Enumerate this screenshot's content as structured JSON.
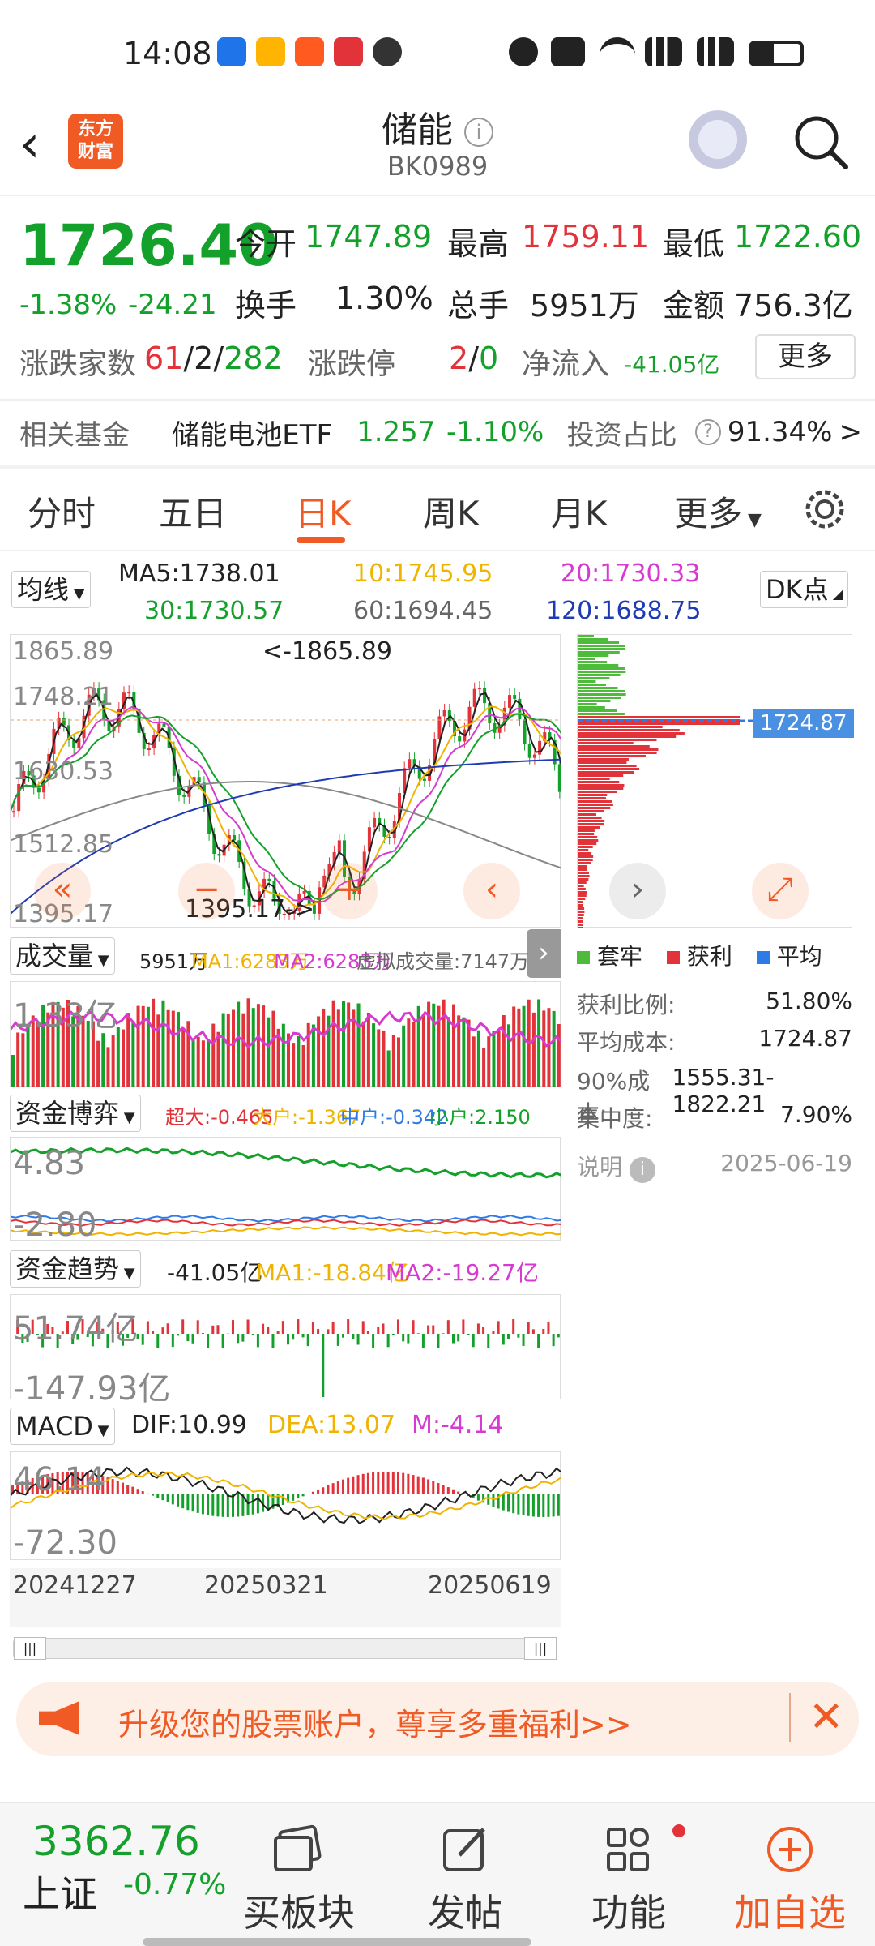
{
  "status_bar": {
    "time": "14:08",
    "icons": [
      "weibo-icon",
      "alipay-icon",
      "taobao-icon",
      "app-icon",
      "plane-icon",
      "alarm-icon",
      "hd-icon",
      "wifi-icon",
      "signal-5g-icon",
      "signal-5g-icon",
      "battery-icon"
    ]
  },
  "header": {
    "logo": "东方\n财富",
    "title": "储能",
    "code": "BK0989"
  },
  "quote": {
    "price": "1726.40",
    "change_pct": "-1.38%",
    "change": "-24.21",
    "open_label": "今开",
    "open": "1747.89",
    "high_label": "最高",
    "high": "1759.11",
    "low_label": "最低",
    "low": "1722.60",
    "turnover_label": "换手",
    "turnover": "1.30%",
    "volume_label": "总手",
    "volume": "5951万",
    "amount_label": "金额",
    "amount": "756.3亿",
    "updown_label": "涨跌家数",
    "up": "61",
    "flat": "2",
    "down": "282",
    "limit_label": "涨跌停",
    "limit_up": "2",
    "limit_down": "0",
    "netflow_label": "净流入",
    "netflow": "-41.05亿",
    "more_button": "更多"
  },
  "fund": {
    "label": "相关基金",
    "name": "储能电池ETF",
    "price": "1.257",
    "pct": "-1.10%",
    "ratio_label": "投资占比",
    "ratio": "91.34%"
  },
  "tabs": [
    "分时",
    "五日",
    "日K",
    "周K",
    "月K",
    "更多"
  ],
  "kline": {
    "ma_selector": "均线",
    "ma5": "MA5:1738.01",
    "ma10": "10:1745.95",
    "ma20": "20:1730.33",
    "ma30": "30:1730.57",
    "ma60": "60:1694.45",
    "ma120": "120:1688.75",
    "dk_button": "DK点",
    "y_labels": [
      "1865.89",
      "1748.21",
      "1630.53",
      "1512.85",
      "1395.17"
    ],
    "max_annot": "<-1865.89",
    "min_annot": "1395.17->",
    "dist_price": "1724.87",
    "colors": {
      "ma5": "#222222",
      "ma10": "#f0b400",
      "ma20": "#d63ad0",
      "ma30": "#14a12b",
      "ma60": "#888888",
      "ma120": "#1f3bb3"
    }
  },
  "volume": {
    "selector": "成交量",
    "vol": "5951万",
    "ma1": "MA1:6283万",
    "ma2": "MA2:6283万",
    "virtual": "虚拟成交量:7147万",
    "y_label": "1.33亿"
  },
  "capital_game": {
    "selector": "资金博弈",
    "big": "超大:-0.465",
    "large": "大户:-1.367",
    "mid": "中户:-0.342",
    "small": "小户:2.150",
    "y_top": "4.83",
    "y_bottom": "-2.80"
  },
  "capital_trend": {
    "selector": "资金趋势",
    "value": "-41.05亿",
    "ma1": "MA1:-18.84亿",
    "ma2": "MA2:-19.27亿",
    "y_top": "51.74亿",
    "y_bottom": "-147.93亿"
  },
  "macd": {
    "selector": "MACD",
    "dif": "DIF:10.99",
    "dea": "DEA:13.07",
    "m": "M:-4.14",
    "y_top": "46.14",
    "y_bottom": "-72.30"
  },
  "dates": [
    "20241227",
    "20250321",
    "20250619"
  ],
  "chip": {
    "legend": [
      "套牢",
      "获利",
      "平均"
    ],
    "profit_ratio_label": "获利比例:",
    "profit_ratio": "51.80%",
    "avg_cost_label": "平均成本:",
    "avg_cost": "1724.87",
    "cost90_label": "90%成本:",
    "cost90": "1555.31-1822.21",
    "concentration_label": "集中度:",
    "concentration": "7.90%",
    "note_label": "说明",
    "date": "2025-06-19"
  },
  "banner": {
    "text": "升级您的股票账户，尊享多重福利>>"
  },
  "bottom_nav": {
    "index_price": "3362.76",
    "index_name": "上证",
    "index_pct": "-0.77%",
    "items": [
      "买板块",
      "发帖",
      "功能",
      "加自选"
    ]
  }
}
